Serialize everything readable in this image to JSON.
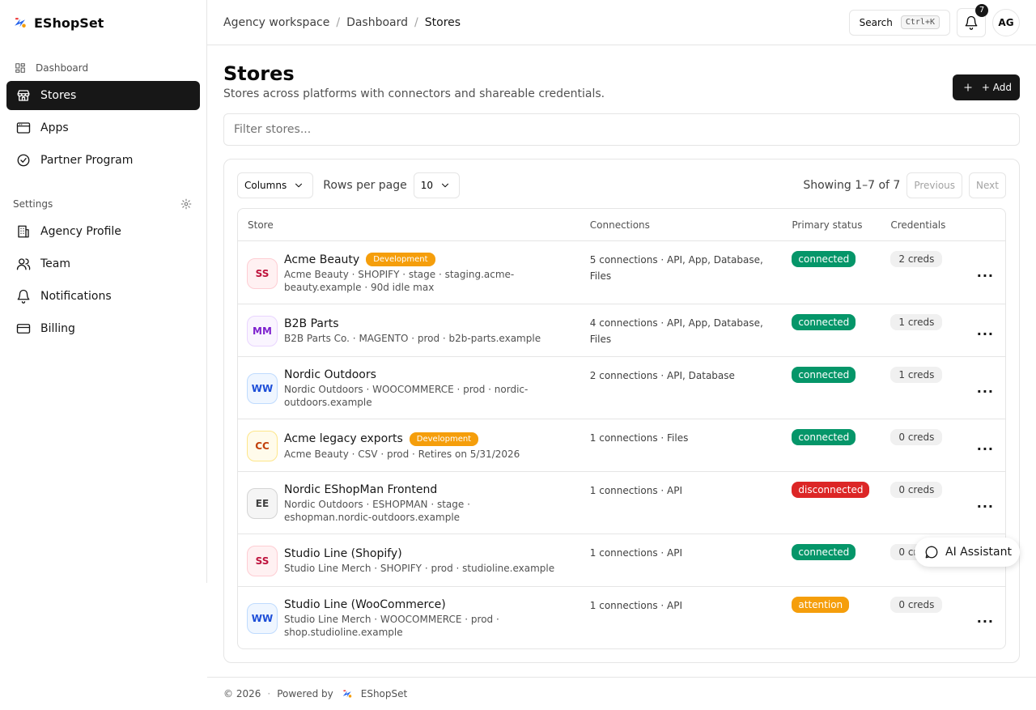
{
  "app": {
    "name": "EShopSet"
  },
  "sidebar": {
    "dashboard_label": "Dashboard",
    "items": [
      {
        "label": "Stores",
        "icon": "store-icon",
        "active": true
      },
      {
        "label": "Apps",
        "icon": "app-window-icon",
        "active": false
      },
      {
        "label": "Partner Program",
        "icon": "badge-check-icon",
        "active": false
      }
    ],
    "settings_label": "Settings",
    "settings_items": [
      {
        "label": "Agency Profile",
        "icon": "building-icon"
      },
      {
        "label": "Team",
        "icon": "users-icon"
      },
      {
        "label": "Notifications",
        "icon": "bell-icon"
      },
      {
        "label": "Billing",
        "icon": "credit-card-icon"
      }
    ]
  },
  "header": {
    "breadcrumb": [
      "Agency workspace",
      "Dashboard",
      "Stores"
    ],
    "search_label": "Search",
    "search_shortcut": "Ctrl+K",
    "notification_count": "7",
    "avatar_initials": "AG"
  },
  "main": {
    "title": "Stores",
    "subtitle": "Stores across platforms with connectors and shareable credentials.",
    "add_label": "+ Add",
    "filter_placeholder": "Filter stores..."
  },
  "table": {
    "columns_label": "Columns",
    "rows_per_page_label": "Rows per page",
    "rows_per_page_value": "10",
    "showing": "Showing 1–7 of 7",
    "previous_label": "Previous",
    "next_label": "Next",
    "headers": [
      "Store",
      "Connections",
      "Primary status",
      "Credentials"
    ],
    "rows": [
      {
        "initials": "SS",
        "name": "Acme Beauty",
        "badge": "Development",
        "meta": "Acme Beauty · SHOPIFY · stage · staging.acme-beauty.example · 90d idle max",
        "connections": "5 connections · API, App, Database, Files",
        "status": "connected",
        "creds": "2 creds"
      },
      {
        "initials": "MM",
        "name": "B2B Parts",
        "badge": "",
        "meta": "B2B Parts Co. · MAGENTO · prod · b2b-parts.example",
        "connections": "4 connections · API, App, Database, Files",
        "status": "connected",
        "creds": "1 creds"
      },
      {
        "initials": "WW",
        "name": "Nordic Outdoors",
        "badge": "",
        "meta": "Nordic Outdoors · WOOCOMMERCE · prod · nordic-outdoors.example",
        "connections": "2 connections · API, Database",
        "status": "connected",
        "creds": "1 creds"
      },
      {
        "initials": "CC",
        "name": "Acme legacy exports",
        "badge": "Development",
        "meta": "Acme Beauty · CSV · prod · Retires on 5/31/2026",
        "connections": "1 connections · Files",
        "status": "connected",
        "creds": "0 creds"
      },
      {
        "initials": "EE",
        "name": "Nordic EShopMan Frontend",
        "badge": "",
        "meta": "Nordic Outdoors · ESHOPMAN · stage · eshopman.nordic-outdoors.example",
        "connections": "1 connections · API",
        "status": "disconnected",
        "creds": "0 creds"
      },
      {
        "initials": "SS",
        "name": "Studio Line (Shopify)",
        "badge": "",
        "meta": "Studio Line Merch · SHOPIFY · prod · studioline.example",
        "connections": "1 connections · API",
        "status": "connected",
        "creds": "0 creds"
      },
      {
        "initials": "WW",
        "name": "Studio Line (WooCommerce)",
        "badge": "",
        "meta": "Studio Line Merch · WOOCOMMERCE · prod · shop.studioline.example",
        "connections": "1 connections · API",
        "status": "attention",
        "creds": "0 creds"
      }
    ],
    "more_label": "..."
  },
  "colors": {
    "connected": "#059669",
    "disconnected": "#dc2626",
    "attention": "#f59e0b",
    "initials": {
      "SS": {
        "fg": "#be123c",
        "bg": "#fff1f2",
        "border": "#fecdd3"
      },
      "MM": {
        "fg": "#7e22ce",
        "bg": "#faf5ff",
        "border": "#e9d5ff"
      },
      "WW": {
        "fg": "#1d4ed8",
        "bg": "#eff6ff",
        "border": "#bfdbfe"
      },
      "CC": {
        "fg": "#c2410c",
        "bg": "#fffbeb",
        "border": "#fde68a"
      },
      "EE": {
        "fg": "#404040",
        "bg": "#f5f5f5",
        "border": "#d4d4d4"
      }
    }
  },
  "ai_assistant_label": "AI Assistant",
  "footer": {
    "copyright": "© 2026",
    "powered_by": "Powered by",
    "brand": "EShopSet"
  }
}
